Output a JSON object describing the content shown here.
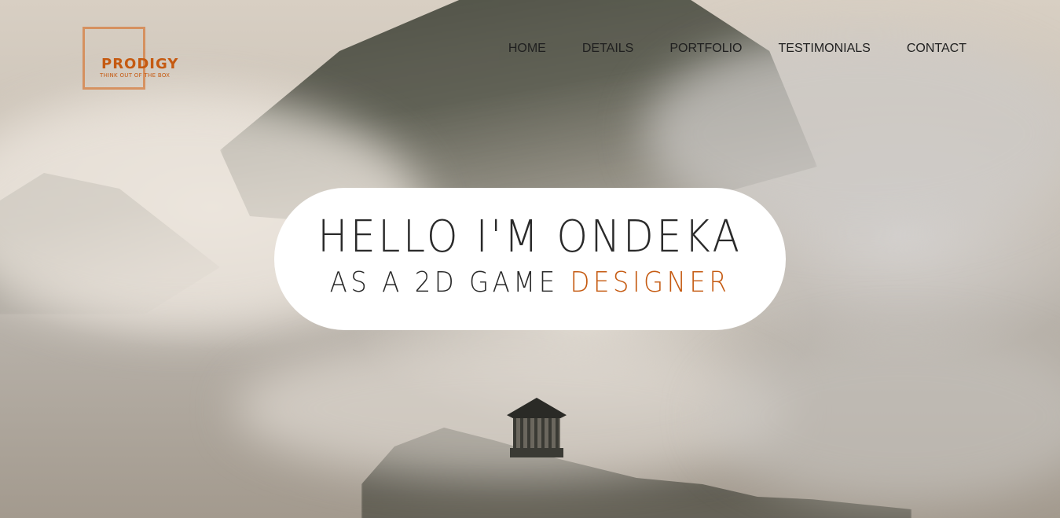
{
  "colors": {
    "accent": "#c55a11",
    "text": "#1f1f1f",
    "pill_background": "#ffffff"
  },
  "logo": {
    "title": "PRODIGY",
    "tagline": "THINK OUT OF THE BOX"
  },
  "nav": {
    "items": [
      {
        "label": "HOME"
      },
      {
        "label": "DETAILS"
      },
      {
        "label": "PORTFOLIO"
      },
      {
        "label": "TESTIMONIALS"
      },
      {
        "label": "CONTACT"
      }
    ]
  },
  "hero": {
    "headline": "HELLO I'M ONDEKA",
    "subline_prefix": "AS A 2D GAME ",
    "subline_accent": "DESIGNER"
  }
}
